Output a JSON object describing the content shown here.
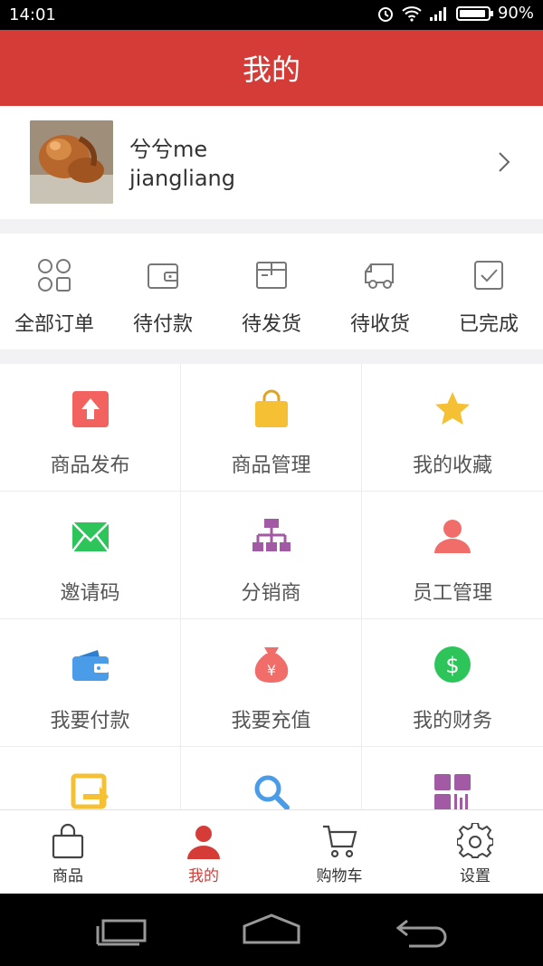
{
  "status": {
    "time": "14:01",
    "battery": "90%"
  },
  "header": {
    "title": "我的"
  },
  "profile": {
    "nickname": "兮兮me",
    "username": "jiangliang"
  },
  "orders": [
    {
      "label": "全部订单",
      "icon": "grid-circles-icon"
    },
    {
      "label": "待付款",
      "icon": "wallet-icon"
    },
    {
      "label": "待发货",
      "icon": "box-icon"
    },
    {
      "label": "待收货",
      "icon": "truck-icon"
    },
    {
      "label": "已完成",
      "icon": "check-box-icon"
    }
  ],
  "grid": [
    {
      "label": "商品发布",
      "icon": "upload-icon",
      "color": "#f2625f"
    },
    {
      "label": "商品管理",
      "icon": "shopping-bag-icon",
      "color": "#f5c033"
    },
    {
      "label": "我的收藏",
      "icon": "star-icon",
      "color": "#f5c033"
    },
    {
      "label": "邀请码",
      "icon": "envelope-icon",
      "color": "#2dc45a"
    },
    {
      "label": "分销商",
      "icon": "org-chart-icon",
      "color": "#a35aa5"
    },
    {
      "label": "员工管理",
      "icon": "person-icon",
      "color": "#f06d6a"
    },
    {
      "label": "我要付款",
      "icon": "wallet-icon",
      "color": "#4a9be8"
    },
    {
      "label": "我要充值",
      "icon": "money-bag-icon",
      "color": "#f06d6a"
    },
    {
      "label": "我的财务",
      "icon": "dollar-icon",
      "color": "#2dc45a"
    },
    {
      "label": "",
      "icon": "transfer-icon",
      "color": "#f5c033"
    },
    {
      "label": "",
      "icon": "search-icon",
      "color": "#4a9be8"
    },
    {
      "label": "",
      "icon": "qr-code-icon",
      "color": "#a35aa5"
    }
  ],
  "tabs": [
    {
      "label": "商品",
      "icon": "bag-icon"
    },
    {
      "label": "我的",
      "icon": "person-icon"
    },
    {
      "label": "购物车",
      "icon": "cart-icon"
    },
    {
      "label": "设置",
      "icon": "gear-icon"
    }
  ],
  "colors": {
    "brand": "#d63c37"
  }
}
